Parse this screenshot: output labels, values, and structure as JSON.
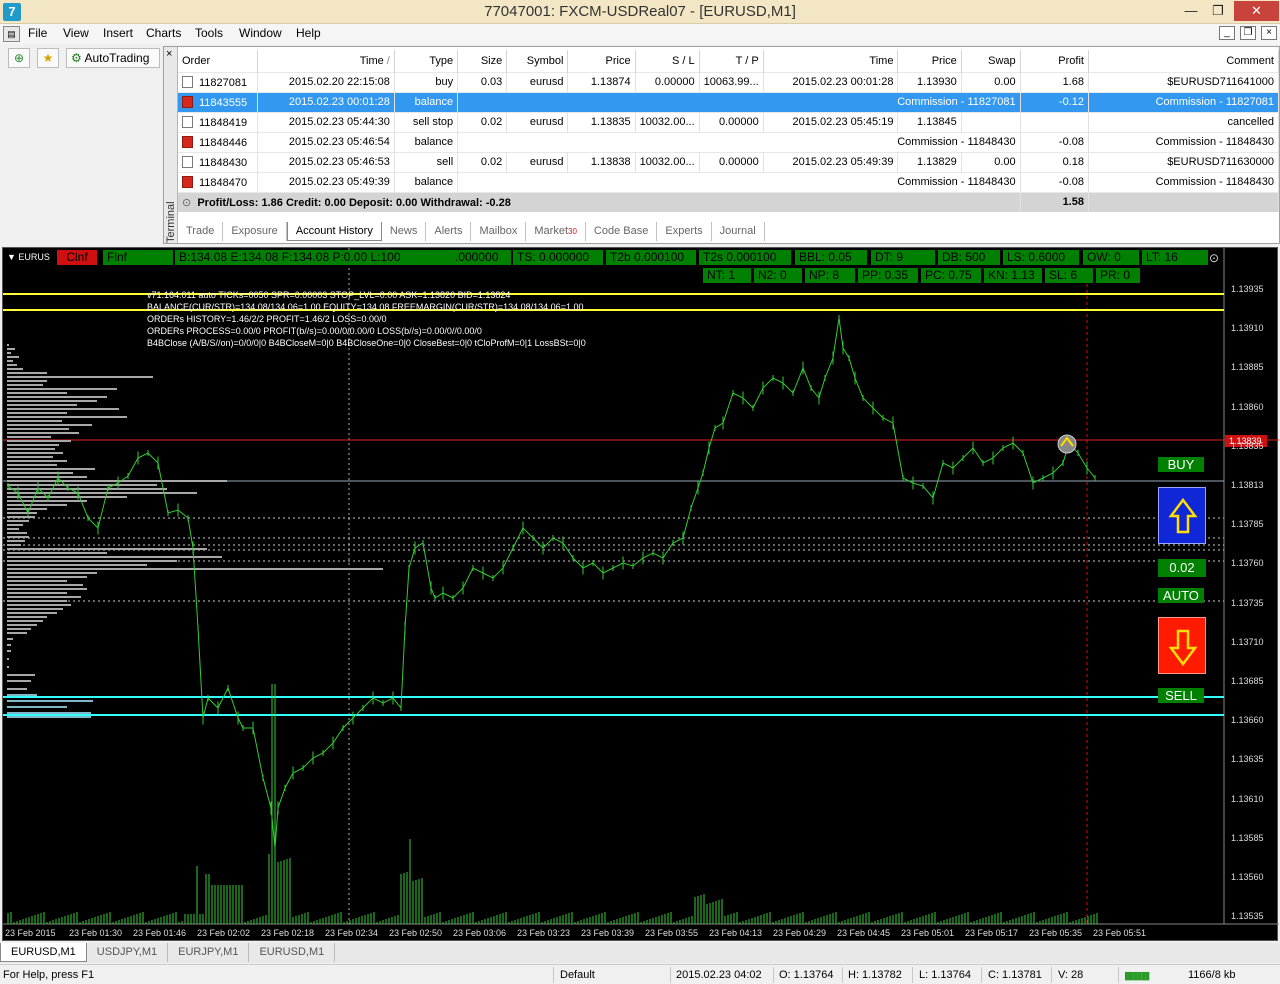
{
  "window": {
    "title": "77047001: FXCM-USDReal07 - [EURUSD,M1]",
    "controls": {
      "minimize": "—",
      "maximize": "❐",
      "close": "✕"
    }
  },
  "menu": [
    "File",
    "View",
    "Insert",
    "Charts",
    "Tools",
    "Window",
    "Help"
  ],
  "toolbar": {
    "autotrading_label": "AutoTrading"
  },
  "terminal": {
    "side_label": "Terminal",
    "columns": [
      "Order",
      "Time",
      "Type",
      "Size",
      "Symbol",
      "Price",
      "S / L",
      "T / P",
      "Time",
      "Price",
      "Swap",
      "Profit",
      "Comment"
    ],
    "sort_marker": "/",
    "rows": [
      {
        "order": "11827081",
        "time": "2015.02.20 22:15:08",
        "type": "buy",
        "size": "0.03",
        "symbol": "eurusd",
        "price": "1.13874",
        "sl": "0.00000",
        "tp": "10063.99...",
        "close_time": "2015.02.23 00:01:28",
        "close_price": "1.13930",
        "swap": "0.00",
        "profit": "1.68",
        "comment": "$EURUSD711641000",
        "selected": false,
        "kind": "trade"
      },
      {
        "order": "11843555",
        "time": "2015.02.23 00:01:28",
        "type": "balance",
        "mid": "Commission - 11827081",
        "profit": "-0.12",
        "comment": "Commission - 11827081",
        "selected": true,
        "kind": "balance"
      },
      {
        "order": "11848419",
        "time": "2015.02.23 05:44:30",
        "type": "sell stop",
        "size": "0.02",
        "symbol": "eurusd",
        "price": "1.13835",
        "sl": "10032.00...",
        "tp": "0.00000",
        "close_time": "2015.02.23 05:45:19",
        "close_price": "1.13845",
        "swap": "",
        "profit": "",
        "comment": "cancelled",
        "selected": false,
        "kind": "trade"
      },
      {
        "order": "11848446",
        "time": "2015.02.23 05:46:54",
        "type": "balance",
        "mid": "Commission - 11848430",
        "profit": "-0.08",
        "comment": "Commission - 11848430",
        "selected": false,
        "kind": "balance"
      },
      {
        "order": "11848430",
        "time": "2015.02.23 05:46:53",
        "type": "sell",
        "size": "0.02",
        "symbol": "eurusd",
        "price": "1.13838",
        "sl": "10032.00...",
        "tp": "0.00000",
        "close_time": "2015.02.23 05:49:39",
        "close_price": "1.13829",
        "swap": "0.00",
        "profit": "0.18",
        "comment": "$EURUSD711630000",
        "selected": false,
        "kind": "trade"
      },
      {
        "order": "11848470",
        "time": "2015.02.23 05:49:39",
        "type": "balance",
        "mid": "Commission - 11848430",
        "profit": "-0.08",
        "comment": "Commission - 11848430",
        "selected": false,
        "kind": "balance"
      }
    ],
    "summary": {
      "text": "Profit/Loss: 1.86  Credit: 0.00  Deposit: 0.00  Withdrawal: -0.28",
      "total": "1.58"
    },
    "tabs": [
      "Trade",
      "Exposure",
      "Account History",
      "News",
      "Alerts",
      "Mailbox",
      "Market",
      "Code Base",
      "Experts",
      "Journal"
    ],
    "market_badge": "30",
    "active_tab": "Account History"
  },
  "chart": {
    "symbol_label": "EURUS",
    "hud_top": [
      "Clnf",
      "Flnf",
      "B:134.08 E:134.08 F:134.08 P:0.00 L:100",
      ".000000",
      "TS:  0.000000",
      "T2b  0.000100",
      "T2s  0.000100",
      "BBL:  0.05",
      "DT:      9",
      "DB:  500",
      "LS:  0.6000",
      "OW:   0",
      "LT:   16"
    ],
    "hud_row2": [
      "NT:   1",
      "N2:   0",
      "NP:   8",
      "PP:  0.35",
      "PC:  0.75",
      "KN:  1.13",
      "SL:   6",
      "PR:   0"
    ],
    "info_lines": [
      "v71.164.011 auto TICKs=0050 SPR=0.00003 STOP_LVL=0.00 ASK=1.13820 BID=1.13824",
      "BALANCE(CUR/STR)=134.08/134.06=1.00 EQUITY=134.08 FREEMARGIN(CUR/STR)=134.08/134.06=1.00",
      "ORDERs HISTORY=1.46/2/2 PROFIT=1.46/2 LOSS=0.00/0",
      "ORDERs PROCESS=0.00/0 PROFIT(b//s)=0.00/0/0.00/0 LOSS(b//s)=0.00/0//0.00/0",
      "B4BClose (A/B/S//on)=0/0/0|0 B4BCloseM=0|0 B4BCloseOne=0|0 CloseBest=0|0 tCloProfM=0|1 LossBSt=0|0"
    ],
    "price_labels": [
      "1.13935",
      "1.13910",
      "1.13885",
      "1.13860",
      "1.13835",
      "1.13813",
      "1.13785",
      "1.13760",
      "1.13735",
      "1.13710",
      "1.13685",
      "1.13660",
      "1.13635",
      "1.13610",
      "1.13585",
      "1.13560",
      "1.13535"
    ],
    "red_price_label": "1.13839",
    "time_labels": [
      "23 Feb 2015",
      "23 Feb 01:30",
      "23 Feb 01:46",
      "23 Feb 02:02",
      "23 Feb 02:18",
      "23 Feb 02:34",
      "23 Feb 02:50",
      "23 Feb 03:06",
      "23 Feb 03:23",
      "23 Feb 03:39",
      "23 Feb 03:55",
      "23 Feb 04:13",
      "23 Feb 04:29",
      "23 Feb 04:45",
      "23 Feb 05:01",
      "23 Feb 05:17",
      "23 Feb 05:35",
      "23 Feb 05:51"
    ],
    "buy_label": "BUY",
    "lot_label": "0.02",
    "auto_label": "AUTO",
    "sell_label": "SELL"
  },
  "chart_tabs": [
    "EURUSD,M1",
    "USDJPY,M1",
    "EURJPY,M1",
    "EURUSD,M1"
  ],
  "status": {
    "help": "For Help, press F1",
    "profile": "Default",
    "time": "2015.02.23 04:02",
    "open": "O: 1.13764",
    "high": "H: 1.13782",
    "low": "L: 1.13764",
    "close": "C: 1.13781",
    "volume": "V: 28",
    "traffic": "1166/8 kb"
  }
}
